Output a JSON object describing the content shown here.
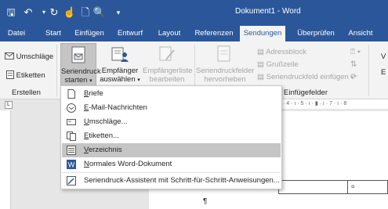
{
  "window": {
    "title": "Dokument1 - Word"
  },
  "tabs": [
    "Datei",
    "Start",
    "Einfügen",
    "Entwurf",
    "Layout",
    "Referenzen",
    "Sendungen",
    "Überprüfen",
    "Ansicht"
  ],
  "ribbon": {
    "umschlaege": "Umschläge",
    "etiketten": "Etiketten",
    "erstellen": "Erstellen",
    "seriendruck_l1": "Seriendruck",
    "seriendruck_l2": "starten",
    "empfaenger_l1": "Empfänger",
    "empfaenger_l2": "auswählen",
    "liste_l1": "Empfängerliste",
    "liste_l2": "bearbeiten",
    "felder_l1": "Seriendruckfelder",
    "felder_l2": "hervorheben",
    "adressblock": "Adressblock",
    "grusszeile": "Grußzeile",
    "einfuegen": "Seriendruckfeld einfügen",
    "einfuegefelder": "Einfügefelder",
    "cut_v": "V",
    "cut_e": "E"
  },
  "menu": {
    "items": [
      {
        "k": "B",
        "rest": "riefe",
        "icon": "page-icon"
      },
      {
        "k": "E",
        "rest": "-Mail-Nachrichten",
        "icon": "email-icon"
      },
      {
        "k": "U",
        "rest": "mschläge...",
        "icon": "envelope-icon"
      },
      {
        "k": "E",
        "rest": "tiketten...",
        "icon": "labels-icon"
      },
      {
        "k": "V",
        "rest": "erzeichnis",
        "icon": "directory-icon",
        "selected": true
      },
      {
        "k": "N",
        "rest": "ormales Word-Dokument",
        "icon": "word-doc-icon"
      },
      {
        "text": "Seriendruck-Assistent mit Schritt-für-Schritt-Anweisungen...",
        "icon": "wizard-icon"
      }
    ]
  },
  "ruler": {
    "marks": "· 4 · ı · 5 · ı · ▮ · ı · 7 · ı · 8"
  },
  "doc": {
    "pilcrow": "¶",
    "cell_mark": "¤"
  }
}
